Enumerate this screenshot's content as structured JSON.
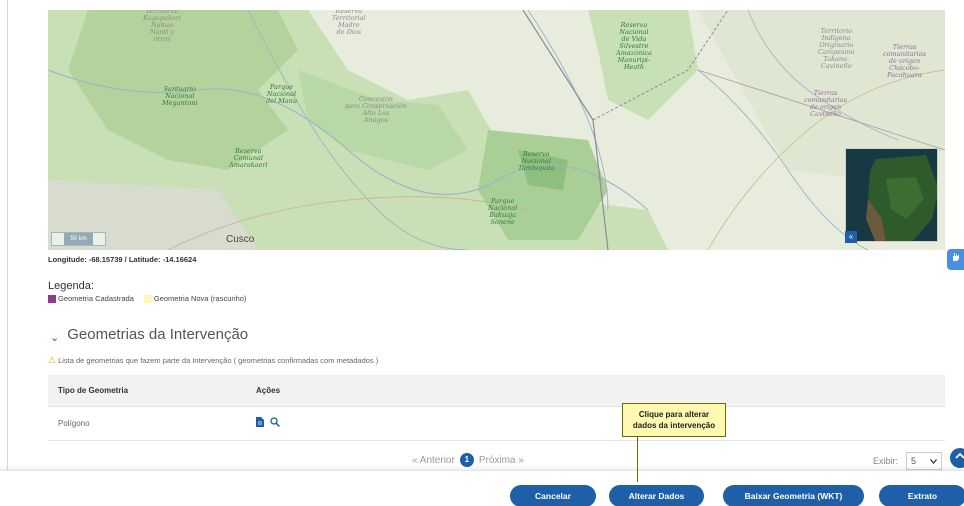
{
  "map": {
    "labels": [
      {
        "text": "Territorial\nKugapakori\nNahua\nNanti y\notros",
        "tone": "grey"
      },
      {
        "text": "Reserva\nTerritorial\nMadre\nde Dios",
        "tone": "grey"
      },
      {
        "text": "Reserva\nNacional\nde Vida\nSilvestre\nAmazónica\nManuripi-\nHeath",
        "tone": "green"
      },
      {
        "text": "Territorio\nIndígena\nOriginario\nCampesino\nTakana-\nCavineño",
        "tone": "grey"
      },
      {
        "text": "Tierras\ncomunitarias\nde origen\nChácobo-\nPacahuara",
        "tone": "purple"
      },
      {
        "text": "Santuario\nNacional\nMegantoni",
        "tone": "green"
      },
      {
        "text": "Parque\nNacional\ndel Manu",
        "tone": "green"
      },
      {
        "text": "Concesión\npara Conservación\nAlto Las\nAmigos",
        "tone": "grey"
      },
      {
        "text": "Tierras\ncomunitarias\nde origen\nCavineño",
        "tone": "purple"
      },
      {
        "text": "Reserva\nComunal\nAmarakaeri",
        "tone": "green"
      },
      {
        "text": "Reserva\nNacional\nTambopata",
        "tone": "green"
      },
      {
        "text": "Parque\nNacional\nBahuaja\nSonene",
        "tone": "green"
      }
    ],
    "city": "Cusco",
    "scale": "50 km",
    "minimap_toggle": "«"
  },
  "coords": "Longitude: -68.15739 / Latitude: -14.16624",
  "legend": {
    "title": "Legenda:",
    "items": [
      {
        "label": "Geometria Cadastrada",
        "color": "#8e3b8e"
      },
      {
        "label": "Geometria Nova (rascunho)",
        "color": "#fff8b0"
      }
    ]
  },
  "section": {
    "chevron": "⌄",
    "title": "Geometrias da Intervenção",
    "info": "Lista de geometrias que fazem parte da Intervenção ( geometrias confirmadas com metadados )"
  },
  "table": {
    "headers": [
      "Tipo de Geometria",
      "Ações"
    ],
    "rows": [
      {
        "tipo": "Polígono"
      }
    ]
  },
  "pager": {
    "prev": "« Anterior",
    "current": "1",
    "next": "Próxima »"
  },
  "exibir": {
    "label": "Exibir:",
    "value": "5"
  },
  "tooltip": {
    "line1": "Clique para alterar",
    "line2": "dados da intervenção"
  },
  "buttons": {
    "cancel": "Cancelar",
    "alter": "Alterar Dados",
    "download": "Baixar Geometria (WKT)",
    "extract": "Extrato"
  },
  "colors": {
    "primary": "#1f5fa8",
    "forest": "#b9d8a8",
    "tooltip_bg": "#fff8b0"
  },
  "icons": {
    "warning": "warning-icon",
    "document": "document-icon",
    "zoom": "zoom-icon",
    "chevron": "chevron-up-icon"
  }
}
